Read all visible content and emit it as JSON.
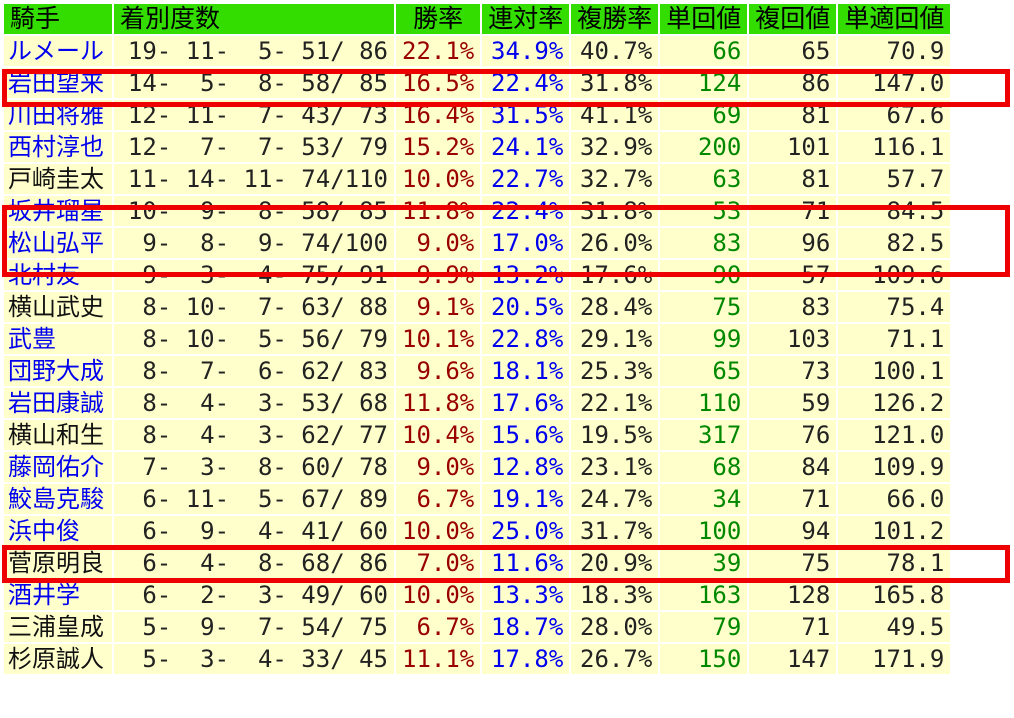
{
  "headers": {
    "jockey": "騎手",
    "record": "着別度数",
    "win_rate": "勝率",
    "quinella_rate": "連対率",
    "place_rate": "複勝率",
    "win_return": "単回値",
    "place_return": "複回値",
    "fair_win_return": "単適回値"
  },
  "rows": [
    {
      "name": "ルメール",
      "record": "19- 11-  5- 51/ 86",
      "win": "22.1%",
      "quin": "34.9%",
      "place": "40.7%",
      "winret": "66",
      "placeret": "65",
      "fair": "70.9",
      "link": true
    },
    {
      "name": "岩田望来",
      "record": "14-  5-  8- 58/ 85",
      "win": "16.5%",
      "quin": "22.4%",
      "place": "31.8%",
      "winret": "124",
      "placeret": "86",
      "fair": "147.0",
      "link": true
    },
    {
      "name": "川田将雅",
      "record": "12- 11-  7- 43/ 73",
      "win": "16.4%",
      "quin": "31.5%",
      "place": "41.1%",
      "winret": "69",
      "placeret": "81",
      "fair": "67.6",
      "link": true
    },
    {
      "name": "西村淳也",
      "record": "12-  7-  7- 53/ 79",
      "win": "15.2%",
      "quin": "24.1%",
      "place": "32.9%",
      "winret": "200",
      "placeret": "101",
      "fair": "116.1",
      "link": true
    },
    {
      "name": "戸崎圭太",
      "record": "11- 14- 11- 74/110",
      "win": "10.0%",
      "quin": "22.7%",
      "place": "32.7%",
      "winret": "63",
      "placeret": "81",
      "fair": "57.7",
      "link": false
    },
    {
      "name": "坂井瑠星",
      "record": "10-  9-  8- 58/ 85",
      "win": "11.8%",
      "quin": "22.4%",
      "place": "31.8%",
      "winret": "53",
      "placeret": "71",
      "fair": "84.5",
      "link": true
    },
    {
      "name": "松山弘平",
      "record": " 9-  8-  9- 74/100",
      "win": "9.0%",
      "quin": "17.0%",
      "place": "26.0%",
      "winret": "83",
      "placeret": "96",
      "fair": "82.5",
      "link": true
    },
    {
      "name": "北村友一",
      "record": " 9-  3-  4- 75/ 91",
      "win": "9.9%",
      "quin": "13.2%",
      "place": "17.6%",
      "winret": "90",
      "placeret": "57",
      "fair": "109.6",
      "link": true
    },
    {
      "name": "横山武史",
      "record": " 8- 10-  7- 63/ 88",
      "win": "9.1%",
      "quin": "20.5%",
      "place": "28.4%",
      "winret": "75",
      "placeret": "83",
      "fair": "75.4",
      "link": false
    },
    {
      "name": "武豊",
      "record": " 8- 10-  5- 56/ 79",
      "win": "10.1%",
      "quin": "22.8%",
      "place": "29.1%",
      "winret": "99",
      "placeret": "103",
      "fair": "71.1",
      "link": true
    },
    {
      "name": "団野大成",
      "record": " 8-  7-  6- 62/ 83",
      "win": "9.6%",
      "quin": "18.1%",
      "place": "25.3%",
      "winret": "65",
      "placeret": "73",
      "fair": "100.1",
      "link": true
    },
    {
      "name": "岩田康誠",
      "record": " 8-  4-  3- 53/ 68",
      "win": "11.8%",
      "quin": "17.6%",
      "place": "22.1%",
      "winret": "110",
      "placeret": "59",
      "fair": "126.2",
      "link": true
    },
    {
      "name": "横山和生",
      "record": " 8-  4-  3- 62/ 77",
      "win": "10.4%",
      "quin": "15.6%",
      "place": "19.5%",
      "winret": "317",
      "placeret": "76",
      "fair": "121.0",
      "link": false
    },
    {
      "name": "藤岡佑介",
      "record": " 7-  3-  8- 60/ 78",
      "win": "9.0%",
      "quin": "12.8%",
      "place": "23.1%",
      "winret": "68",
      "placeret": "84",
      "fair": "109.9",
      "link": true
    },
    {
      "name": "鮫島克駿",
      "record": " 6- 11-  5- 67/ 89",
      "win": "6.7%",
      "quin": "19.1%",
      "place": "24.7%",
      "winret": "34",
      "placeret": "71",
      "fair": "66.0",
      "link": true
    },
    {
      "name": "浜中俊",
      "record": " 6-  9-  4- 41/ 60",
      "win": "10.0%",
      "quin": "25.0%",
      "place": "31.7%",
      "winret": "100",
      "placeret": "94",
      "fair": "101.2",
      "link": true
    },
    {
      "name": "菅原明良",
      "record": " 6-  4-  8- 68/ 86",
      "win": "7.0%",
      "quin": "11.6%",
      "place": "20.9%",
      "winret": "39",
      "placeret": "75",
      "fair": "78.1",
      "link": false
    },
    {
      "name": "酒井学",
      "record": " 6-  2-  3- 49/ 60",
      "win": "10.0%",
      "quin": "13.3%",
      "place": "18.3%",
      "winret": "163",
      "placeret": "128",
      "fair": "165.8",
      "link": true
    },
    {
      "name": "三浦皇成",
      "record": " 5-  9-  7- 54/ 75",
      "win": "6.7%",
      "quin": "18.7%",
      "place": "28.0%",
      "winret": "79",
      "placeret": "71",
      "fair": "49.5",
      "link": false
    },
    {
      "name": "杉原誠人",
      "record": " 5-  3-  4- 33/ 45",
      "win": "11.1%",
      "quin": "17.8%",
      "place": "26.7%",
      "winret": "150",
      "placeret": "147",
      "fair": "171.9",
      "link": false
    }
  ],
  "colors": {
    "header_bg": "#33dd00",
    "row_bg": "#ffffcc",
    "link_name": "#0000ee",
    "win_rate": "#990000",
    "quinella_rate": "#0000ee",
    "win_return": "#008800",
    "highlight": "#ee0000"
  }
}
